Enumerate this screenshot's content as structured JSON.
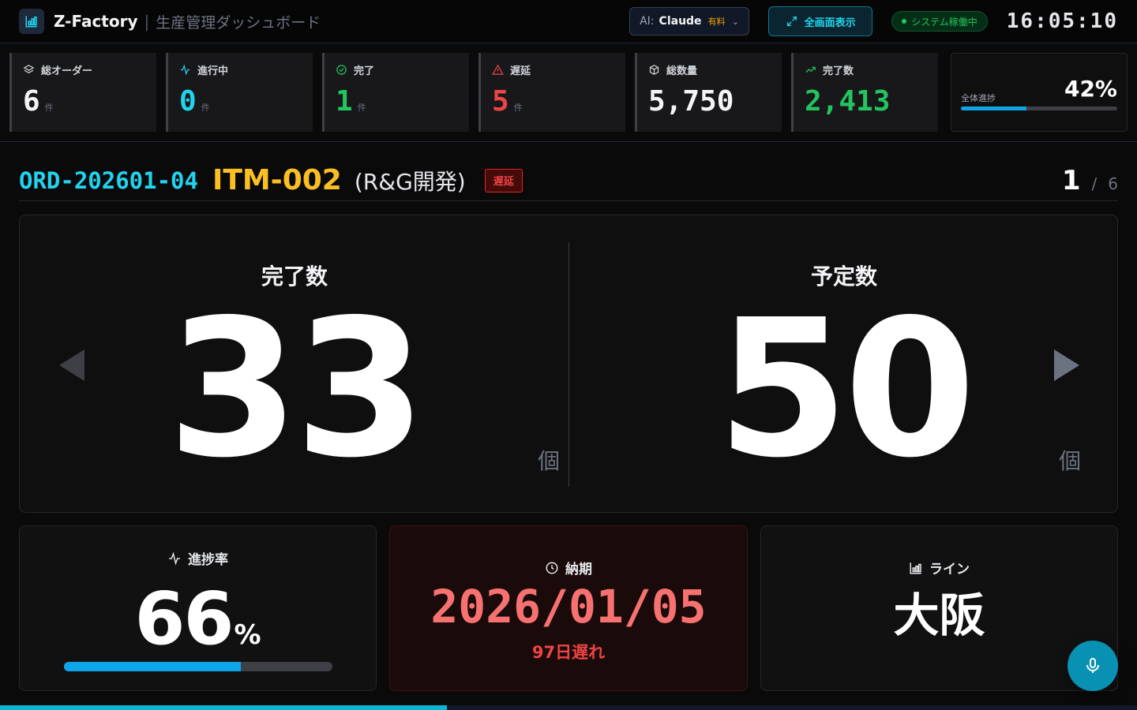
{
  "header": {
    "app_name": "Z-Factory",
    "separator": "|",
    "subtitle": "生産管理ダッシュボード",
    "ai_label": "AI:",
    "ai_value": "Claude",
    "ai_tier": "有料",
    "fullscreen_label": "全画面表示",
    "status_label": "システム稼働中",
    "clock": "16:05:10"
  },
  "kpis": [
    {
      "label": "総オーダー",
      "value": "6",
      "unit": "件",
      "color": "#f3f4f6",
      "icon": "layers-icon"
    },
    {
      "label": "進行中",
      "value": "0",
      "unit": "件",
      "color": "#22d3ee",
      "icon": "activity-icon"
    },
    {
      "label": "完了",
      "value": "1",
      "unit": "件",
      "color": "#22c55e",
      "icon": "check-circle-icon"
    },
    {
      "label": "遅延",
      "value": "5",
      "unit": "件",
      "color": "#ef4444",
      "icon": "alert-triangle-icon"
    },
    {
      "label": "総数量",
      "value": "5,750",
      "unit": "",
      "color": "#f3f4f6",
      "icon": "box-icon"
    },
    {
      "label": "完了数",
      "value": "2,413",
      "unit": "",
      "color": "#22c55e",
      "icon": "trending-up-icon"
    }
  ],
  "overall": {
    "label": "全体進捗",
    "percent": "42%",
    "fraction": 0.42
  },
  "order": {
    "id": "ORD-202601-04",
    "item_code": "ITM-002",
    "item_name": "(R&G開発)",
    "status": "遅延",
    "page_current": "1",
    "page_sep": "/",
    "page_total": "6"
  },
  "counts": {
    "done_label": "完了数",
    "done_value": "33",
    "planned_label": "予定数",
    "planned_value": "50",
    "unit": "個"
  },
  "progress": {
    "label": "進捗率",
    "value": "66",
    "unit": "%",
    "fraction": 0.66
  },
  "due": {
    "label": "納期",
    "date": "2026/01/05",
    "late_text": "97日遅れ"
  },
  "line": {
    "label": "ライン",
    "value": "大阪"
  },
  "page_progress": {
    "fraction": 0.393
  }
}
